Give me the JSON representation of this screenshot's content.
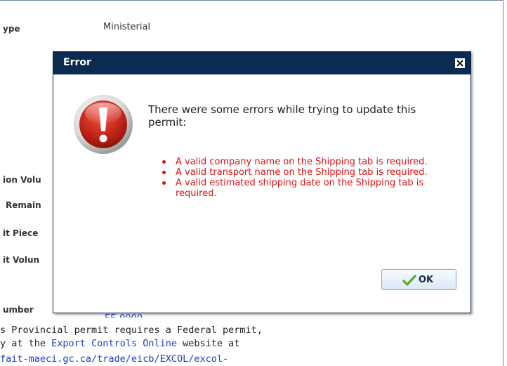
{
  "background": {
    "fields": [
      {
        "label": "ype",
        "value": "Ministerial"
      },
      {
        "label": "ion Volu"
      },
      {
        "label": "Remain"
      },
      {
        "label": "it Piece"
      },
      {
        "label": "it Volun"
      },
      {
        "label": "umber",
        "value_partial": "EE-0000"
      }
    ],
    "paragraph": {
      "line1": "s Provincial permit requires a Federal permit,",
      "line2_prefix": "y at the ",
      "line2_link": "Export Controls Online",
      "line2_suffix": " website at",
      "line3_link": "fait-maeci.gc.ca/trade/eicb/EXCOL/excol-"
    }
  },
  "dialog": {
    "title": "Error",
    "message": "There were some errors while trying to update this permit:",
    "errors": [
      "A valid company name on the Shipping tab is required.",
      "A valid transport name on the Shipping tab is required.",
      "A valid estimated shipping date on the Shipping tab is required."
    ],
    "ok_label": "OK",
    "icons": {
      "close": "close-icon",
      "error": "error-icon",
      "ok": "checkmark-icon"
    },
    "colors": {
      "titlebar": "#0c2b52",
      "error_text": "#e01010",
      "error_icon": "#c8261b",
      "check": "#5aaa28"
    }
  }
}
